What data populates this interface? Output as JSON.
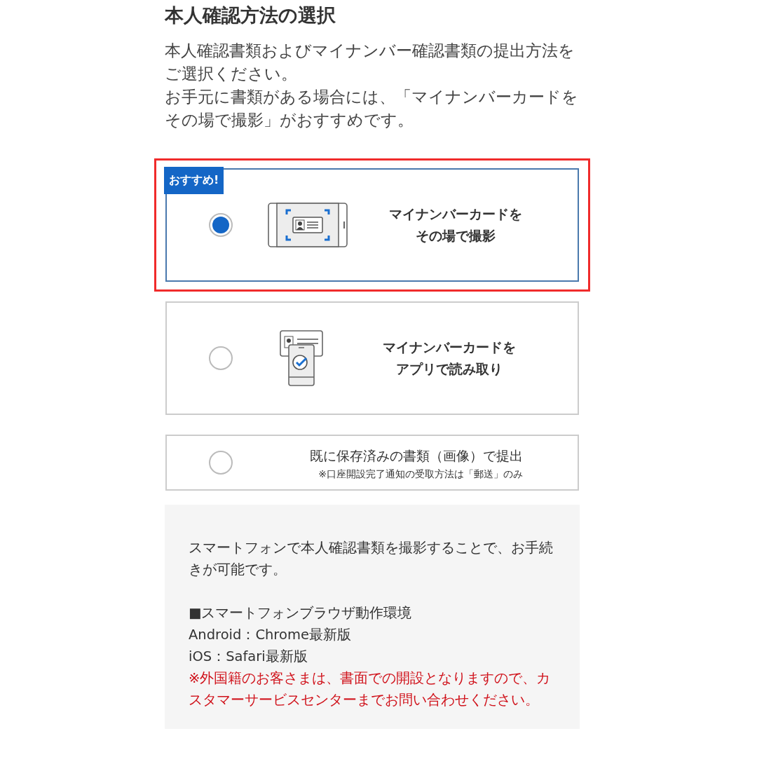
{
  "title": "本人確認方法の選択",
  "intro": [
    "本人確認書類およびマイナンバー確認書類の提出方法をご選択ください。",
    "お手元に書類がある場合には、「マイナンバーカードをその場で撮影」がおすすめです。"
  ],
  "options": [
    {
      "kind": "scan",
      "selected": true,
      "highlighted": true,
      "badge": "おすすめ!",
      "label": "マイナンバーカードをその場で撮影"
    },
    {
      "kind": "app",
      "selected": false,
      "highlighted": false,
      "label": "マイナンバーカードをアプリで読み取り"
    },
    {
      "kind": "plain",
      "selected": false,
      "highlighted": false,
      "label": "既に保存済みの書類（画像）で提出",
      "note": "※口座開設完了通知の受取方法は「郵送」のみ"
    }
  ],
  "info": [
    {
      "kind": "text",
      "text": "スマートフォンで本人確認書類を撮影することで、お手続きが可能です。"
    },
    {
      "kind": "heading",
      "text": "■スマートフォンブラウザ動作環境"
    },
    {
      "kind": "line",
      "text": "Android：Chrome最新版"
    },
    {
      "kind": "line",
      "text": "iOS：Safari最新版"
    },
    {
      "kind": "warning",
      "text": "※外国籍のお客さまは、書面での開設となりますので、カスタマーサービスセンターまでお問い合わせください。"
    }
  ]
}
